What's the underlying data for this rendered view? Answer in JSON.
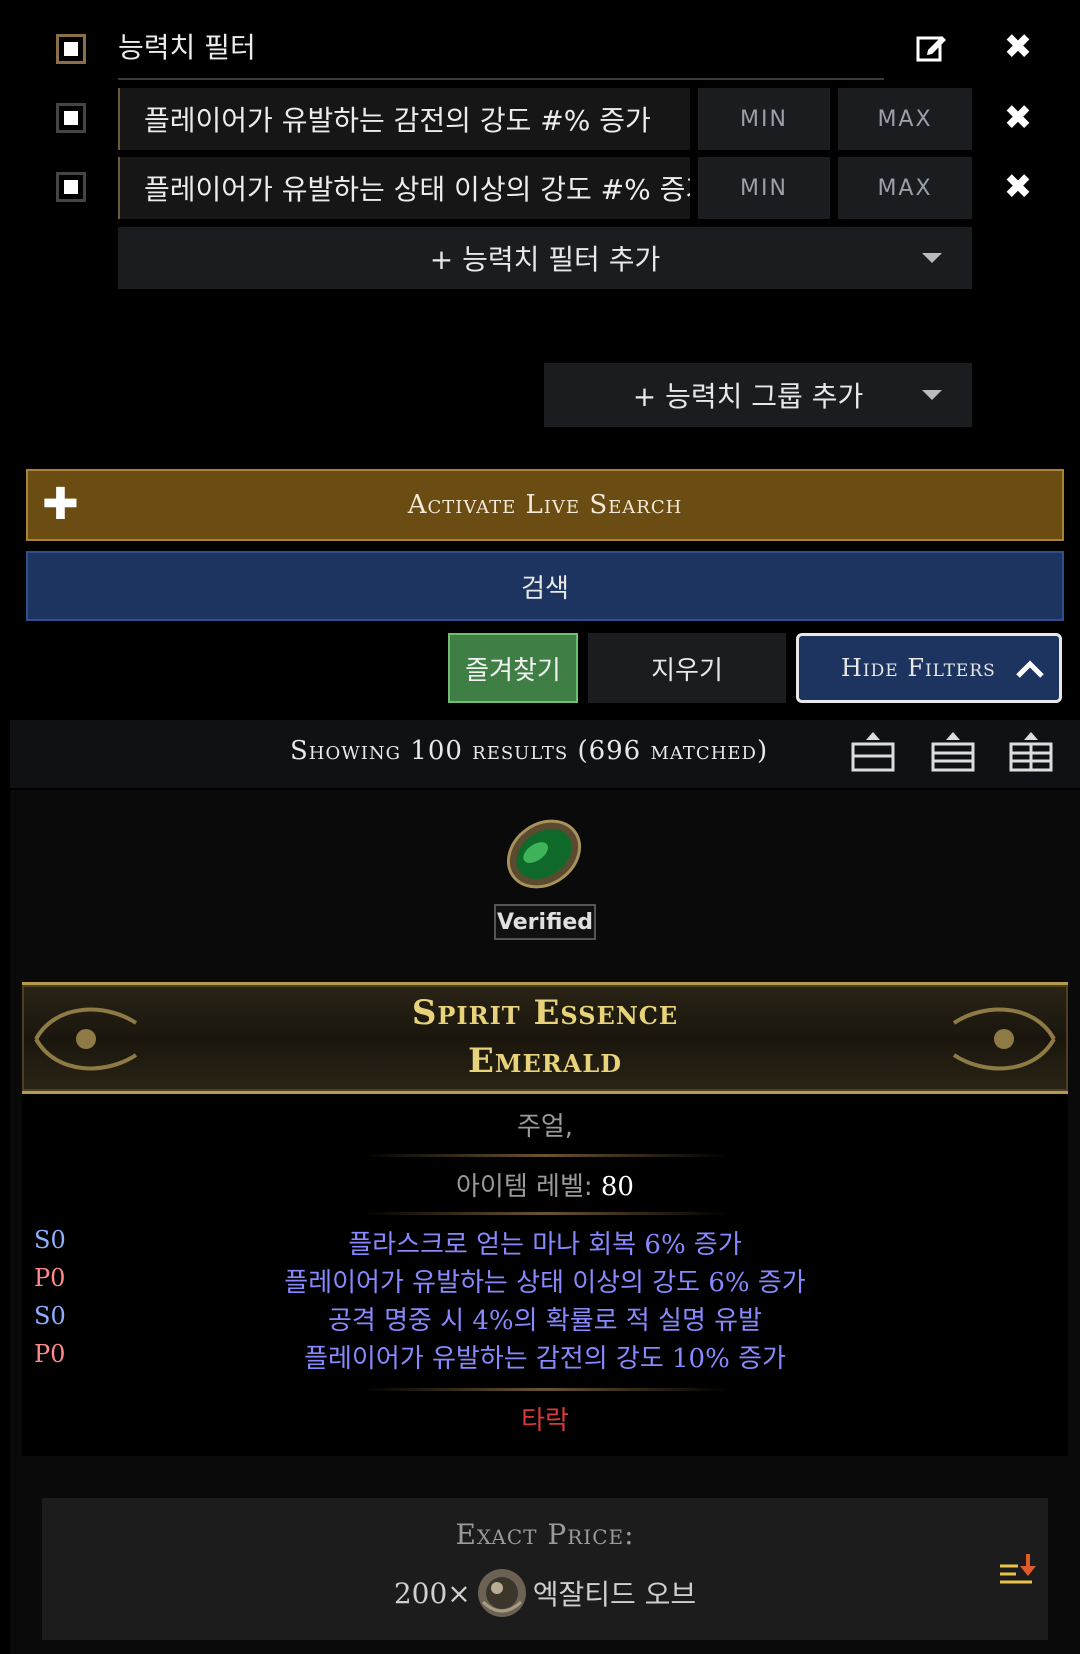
{
  "filters": {
    "group_title": "능력치 필터",
    "rows": [
      {
        "label": "플레이어가 유발하는 감전의 강도 #% 증가",
        "min_placeholder": "MIN",
        "max_placeholder": "MAX"
      },
      {
        "label": "플레이어가 유발하는 상태 이상의 강도 #% 증가",
        "min_placeholder": "MIN",
        "max_placeholder": "MAX"
      }
    ],
    "add_stat_filter": "+ 능력치 필터 추가",
    "add_stat_group": "+ 능력치 그룹 추가"
  },
  "actions": {
    "live_search": "Activate Live Search",
    "search": "검색",
    "favorites": "즐겨찾기",
    "clear": "지우기",
    "hide_filters": "Hide Filters"
  },
  "results": {
    "summary": "Showing 100 results (696 matched)"
  },
  "item": {
    "verified": "Verified",
    "name_line1": "Spirit Essence",
    "name_line2": "Emerald",
    "type": "주얼,",
    "level_label": "아이템 레벨:",
    "level_value": "80",
    "mods": [
      {
        "tag": "S0",
        "text": "플라스크로 얻는 마나 회복 6% 증가",
        "tag_color": "#8fb0ff"
      },
      {
        "tag": "P0",
        "text": "플레이어가 유발하는 상태 이상의 강도 6% 증가",
        "tag_color": "#ff8a8a"
      },
      {
        "tag": "S0",
        "text": "공격 명중 시 4%의 확률로 적 실명 유발",
        "tag_color": "#8fb0ff"
      },
      {
        "tag": "P0",
        "text": "플레이어가 유발하는 감전의 강도 10% 증가",
        "tag_color": "#ff8a8a"
      }
    ],
    "corrupted": "타락"
  },
  "price": {
    "label": "Exact Price:",
    "amount": "200×",
    "currency": "엑잘티드 오브"
  },
  "colors": {
    "live_search_bg": "#6b4c12",
    "search_bg": "#1d3461",
    "favorites_bg": "#3f7f45",
    "mod_color": "#8888ff",
    "corrupted": "#d63a3a"
  }
}
